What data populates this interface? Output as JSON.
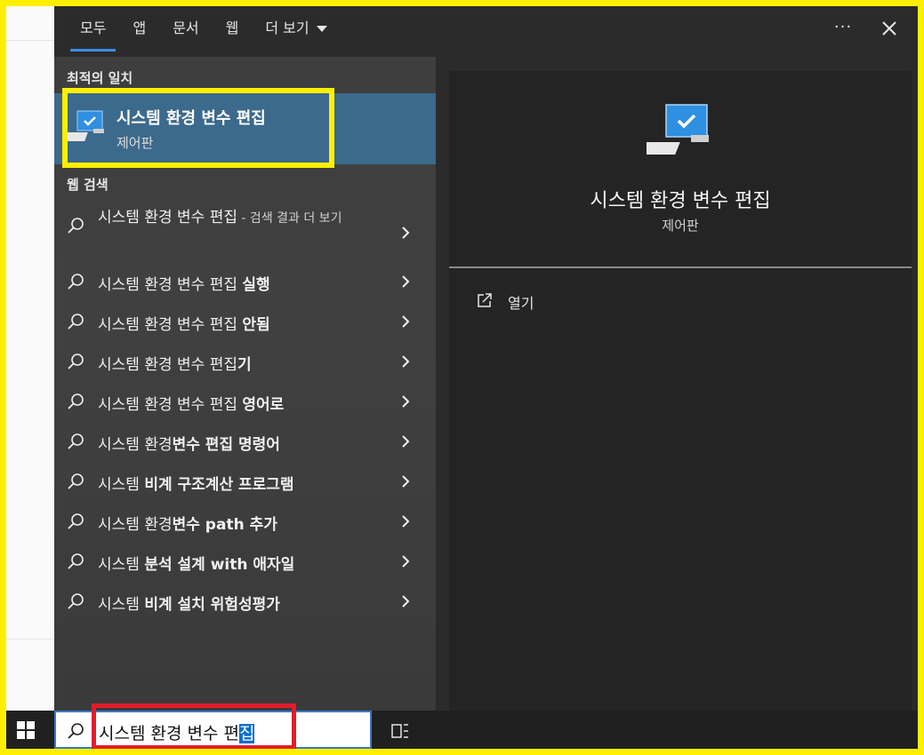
{
  "tabs": [
    {
      "label": "모두"
    },
    {
      "label": "앱"
    },
    {
      "label": "문서"
    },
    {
      "label": "웹"
    },
    {
      "label": "더 보기"
    }
  ],
  "more_label": "···",
  "best_match": {
    "section_title": "최적의 일치",
    "title": "시스템 환경 변수 편집",
    "subtitle": "제어판"
  },
  "web_search": {
    "section_title": "웹 검색",
    "first": {
      "base": "시스템 환경 변수 편집",
      "suffix": " - 검색 결과 더 보기"
    },
    "items": [
      {
        "normal": "시스템 환경 변수 편집 ",
        "bold": "실행"
      },
      {
        "normal": "시스템 환경 변수 편집 ",
        "bold": "안됨"
      },
      {
        "normal": "시스템 환경 변수 편집",
        "bold": "기"
      },
      {
        "normal": "시스템 환경 변수 편집 ",
        "bold": "영어로"
      },
      {
        "normal": "시스템 환경",
        "bold": "변수 편집 명령어"
      },
      {
        "normal": "시스템 ",
        "bold": "비계 구조계산 프로그램"
      },
      {
        "normal": "시스템 환경",
        "bold": "변수 path 추가"
      },
      {
        "normal": "시스템 ",
        "bold": "분석 설계 with 애자일"
      },
      {
        "normal": "시스템 ",
        "bold": "비계 설치 위험성평가"
      }
    ]
  },
  "detail": {
    "title": "시스템 환경 변수 편집",
    "subtitle": "제어판",
    "open_label": "열기"
  },
  "search": {
    "typed": "시스템 환경 변수 편",
    "selected": "집"
  },
  "colors": {
    "highlight_yellow": "#ffef00",
    "highlight_red": "#e11d2a",
    "accent_blue": "#3a8de0",
    "best_match_bg": "#3c6a8c"
  }
}
